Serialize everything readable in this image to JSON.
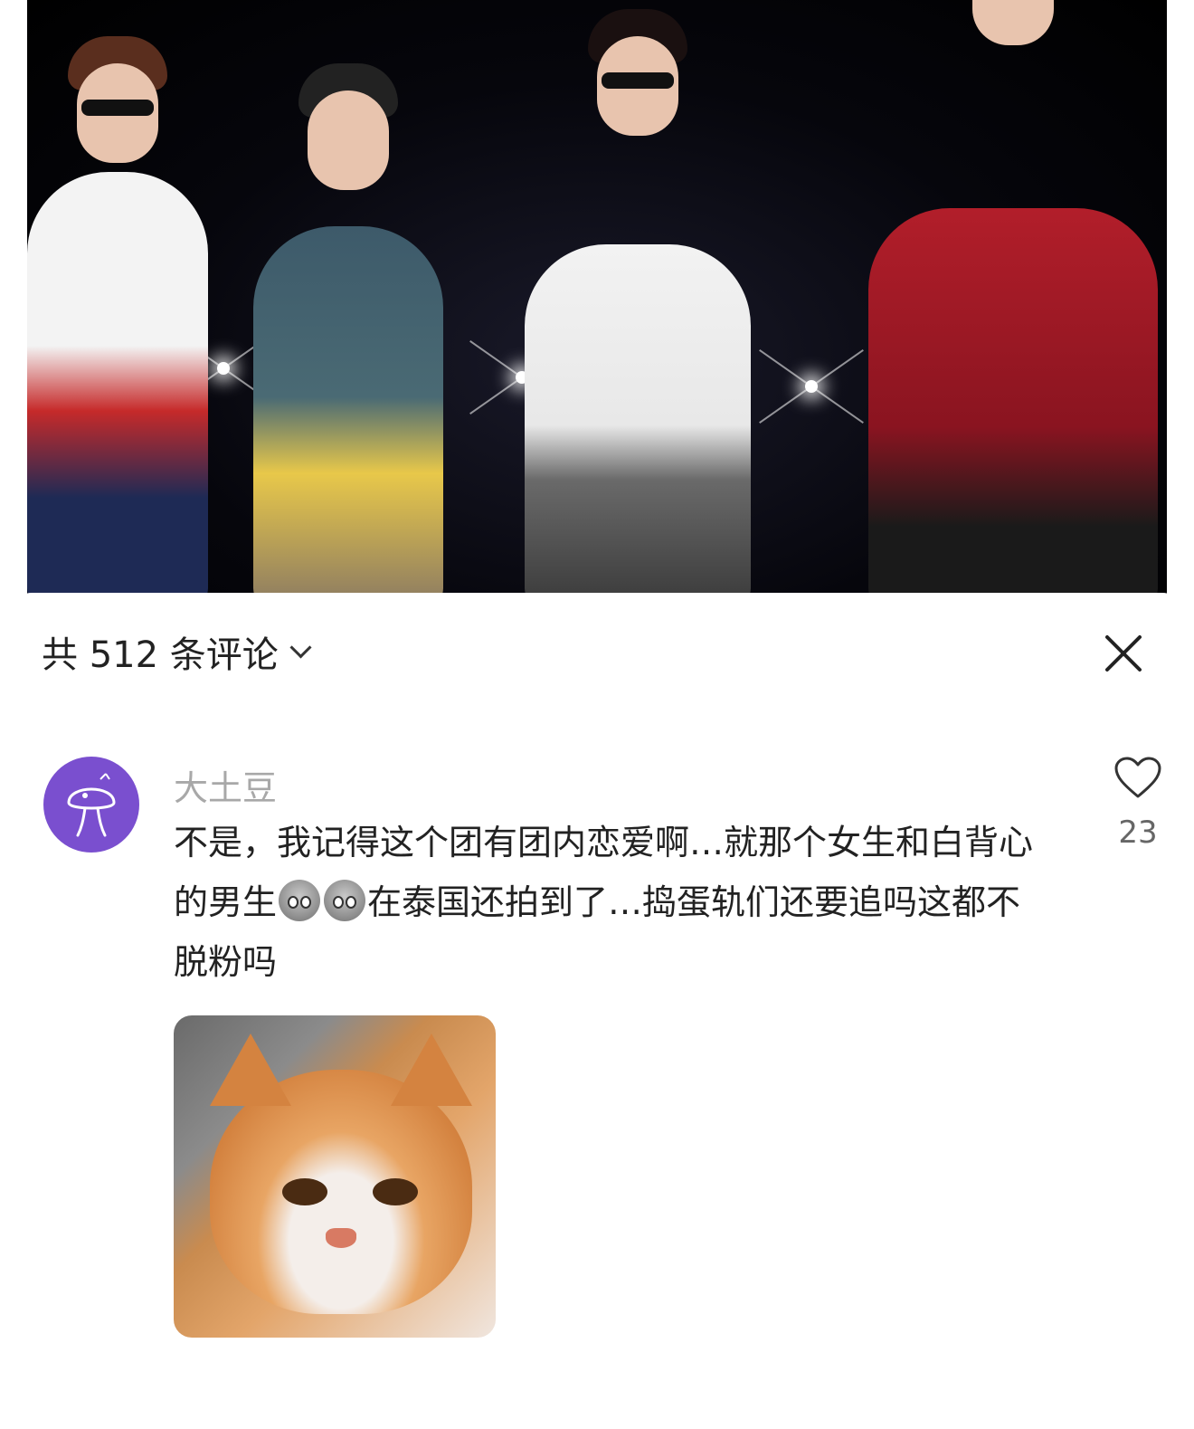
{
  "header": {
    "comment_count_label": "共 512 条评论"
  },
  "comment": {
    "username": "大土豆",
    "text_part1": "不是，我记得这个团有团内恋爱啊…就那个女生和白背心的男生",
    "text_part2": "在泰国还拍到了…捣蛋轨们还要追吗这都不脱粉吗",
    "like_count": "23"
  },
  "colors": {
    "avatar_bg": "#7a4fcf",
    "username": "#a8a8a8",
    "text": "#222222"
  },
  "icons": {
    "close": "close-icon",
    "heart": "heart-icon",
    "chevron": "chevron-down-icon"
  }
}
